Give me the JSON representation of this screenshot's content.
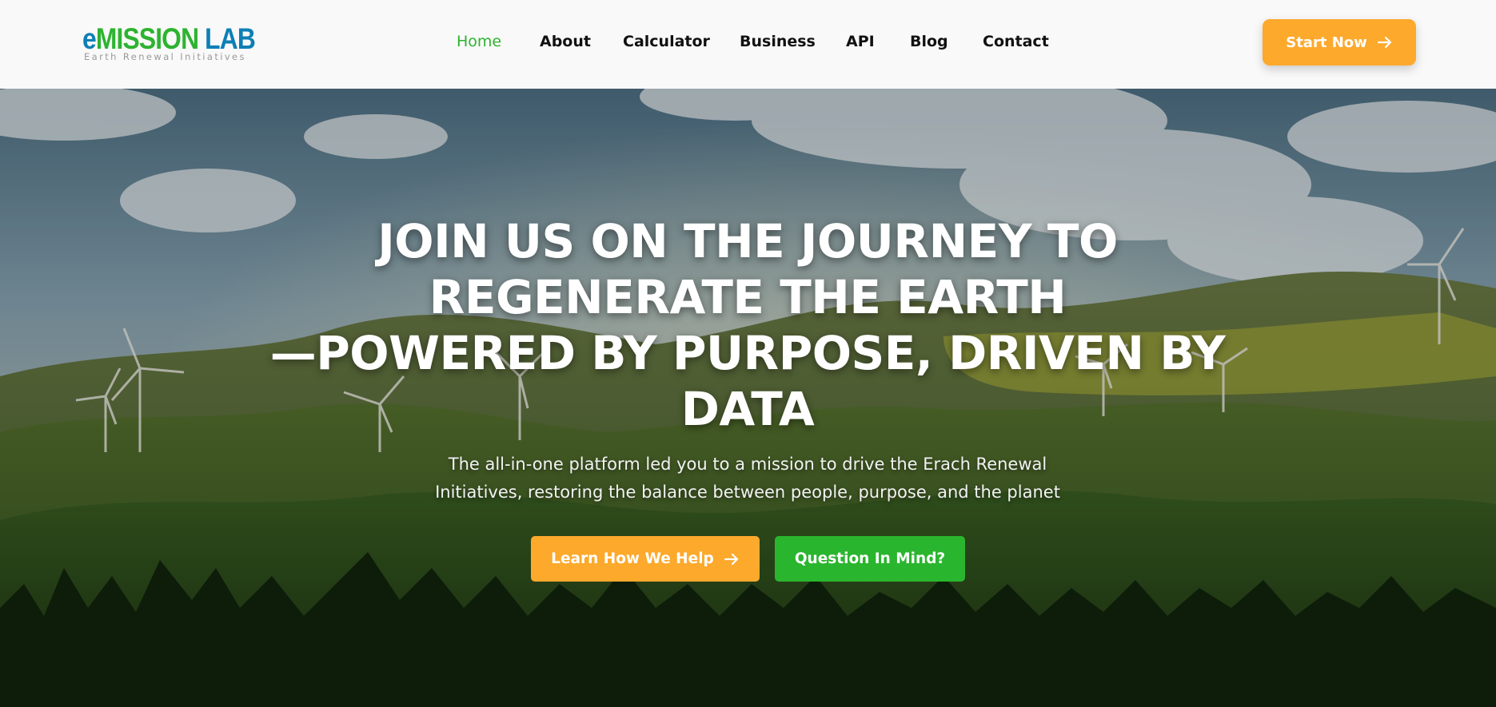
{
  "brand": {
    "logo_e": "e",
    "logo_mission": "MISSION",
    "logo_lab": " LAB",
    "tagline": "Earth Renewal Initiatives"
  },
  "nav": {
    "items": [
      {
        "label": "Home",
        "active": true
      },
      {
        "label": "About",
        "active": false
      },
      {
        "label": "Calculator",
        "active": false
      },
      {
        "label": "Business",
        "active": false
      },
      {
        "label": "API",
        "active": false
      },
      {
        "label": "Blog",
        "active": false
      },
      {
        "label": "Contact",
        "active": false
      }
    ],
    "cta_label": "Start Now",
    "cta_icon": "arrow-right-icon"
  },
  "hero": {
    "headline_lines": [
      "JOIN US ON THE JOURNEY TO",
      "REGENERATE THE EARTH",
      "—POWERED BY PURPOSE, DRIVEN BY",
      "DATA"
    ],
    "subtext_lines": [
      "The all-in-one platform led you to a mission to drive the Erach Renewal",
      "Initiatives, restoring the balance between people, purpose, and the planet"
    ],
    "primary_button": "Learn How We Help",
    "primary_button_icon": "arrow-right-icon",
    "secondary_button": "Question In Mind?"
  },
  "colors": {
    "accent_orange": "#fda92c",
    "accent_green": "#2ab52e",
    "brand_blue": "#0d7fb5",
    "nav_active": "#2db330"
  }
}
